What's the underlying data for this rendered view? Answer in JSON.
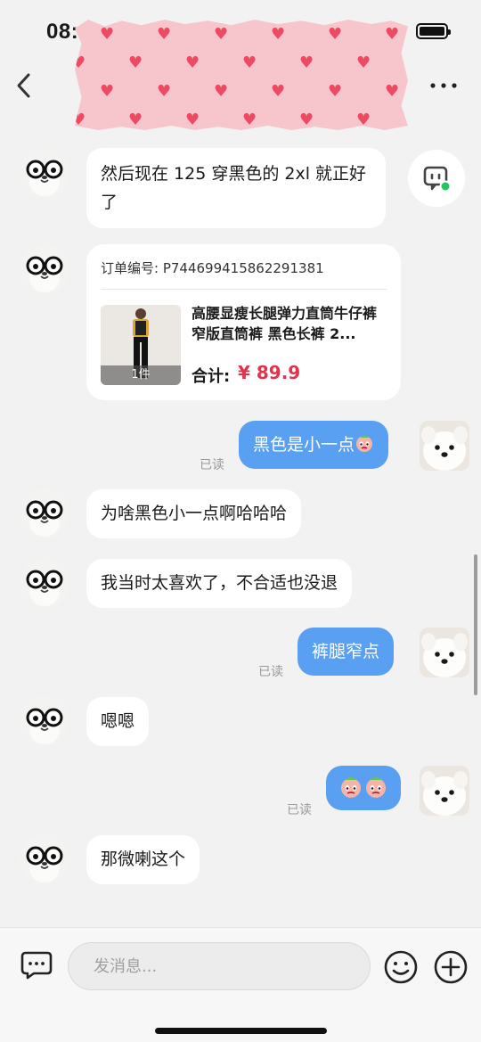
{
  "status_bar": {
    "time": "08:",
    "battery_icon": "battery-icon"
  },
  "header": {
    "back_icon": "chevron-left-icon",
    "more_icon": "more-dots-icon",
    "title_censored": true
  },
  "messages": [
    {
      "side": "left",
      "text": "然后现在 125 穿黑色的 2xl 就正好了"
    },
    {
      "side": "left",
      "type": "order",
      "order_no": "订单编号: P744699415862291381",
      "title": "高腰显瘦长腿弹力直筒牛仔裤窄版直筒裤 黑色长裤 2...",
      "qty": "1件",
      "total_label": "合计:",
      "total": "¥ 89.9"
    },
    {
      "side": "right",
      "text": "黑色是小一点",
      "read": "已读"
    },
    {
      "side": "left",
      "text": "为啥黑色小一点啊哈哈哈"
    },
    {
      "side": "left",
      "text": "我当时太喜欢了，不合适也没退"
    },
    {
      "side": "right",
      "text": "裤腿窄点",
      "read": "已读"
    },
    {
      "side": "left",
      "text": "嗯嗯"
    },
    {
      "side": "right",
      "text": "",
      "stickers": 2,
      "read": "已读"
    },
    {
      "side": "left",
      "text": "那微喇这个"
    }
  ],
  "input_bar": {
    "placeholder": "发消息..."
  },
  "colors": {
    "bubble_right": "#5aa0f2",
    "price": "#e0344c",
    "background": "#f2f2f2",
    "online_dot": "#22c55e"
  }
}
